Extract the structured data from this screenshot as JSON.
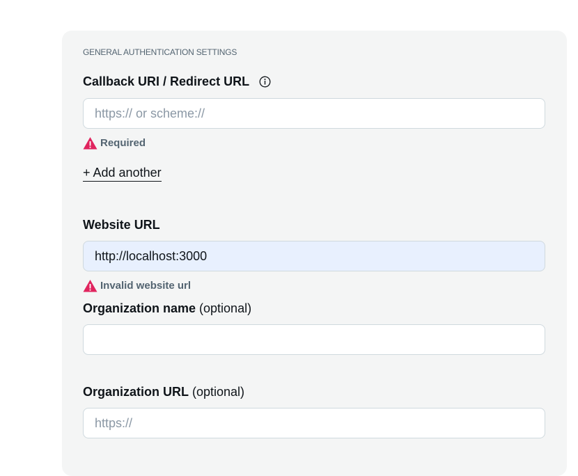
{
  "section": {
    "title": "GENERAL AUTHENTICATION SETTINGS"
  },
  "callback": {
    "label": "Callback URI / Redirect URL",
    "info_icon": "info-icon",
    "placeholder": "https:// or scheme://",
    "value": "",
    "error": "Required",
    "add_another": "+ Add another"
  },
  "website": {
    "label": "Website URL",
    "value": "http://localhost:3000",
    "error": "Invalid website url"
  },
  "org_name": {
    "label": "Organization name",
    "optional": "(optional)",
    "placeholder": "",
    "value": ""
  },
  "org_url": {
    "label": "Organization URL",
    "optional": "(optional)",
    "placeholder": "https://",
    "value": ""
  },
  "colors": {
    "panel_bg": "#f4f5f5",
    "error_red": "#e0245e",
    "autofill_bg": "#e8f0fe"
  }
}
